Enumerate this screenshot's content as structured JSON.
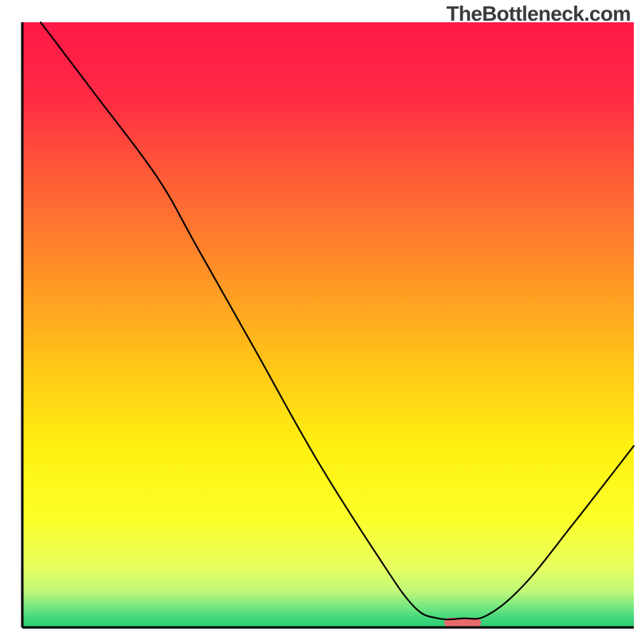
{
  "watermark": "TheBottleneck.com",
  "chart_data": {
    "type": "line",
    "title": "",
    "xlabel": "",
    "ylabel": "",
    "xlim": [
      0,
      100
    ],
    "ylim": [
      0,
      100
    ],
    "background_gradient": {
      "type": "vertical",
      "stops": [
        {
          "offset": 0.0,
          "color": "#ff1848"
        },
        {
          "offset": 0.12,
          "color": "#ff2a44"
        },
        {
          "offset": 0.25,
          "color": "#ff5a38"
        },
        {
          "offset": 0.4,
          "color": "#ff8c28"
        },
        {
          "offset": 0.55,
          "color": "#ffc018"
        },
        {
          "offset": 0.7,
          "color": "#fff010"
        },
        {
          "offset": 0.82,
          "color": "#fbff28"
        },
        {
          "offset": 0.9,
          "color": "#e8ff60"
        },
        {
          "offset": 0.94,
          "color": "#c0f878"
        },
        {
          "offset": 0.965,
          "color": "#78e880"
        },
        {
          "offset": 0.985,
          "color": "#40d87c"
        },
        {
          "offset": 1.0,
          "color": "#28cc70"
        }
      ]
    },
    "axis_color": "#000000",
    "series": [
      {
        "name": "bottleneck-curve",
        "color": "#000000",
        "stroke_width": 2.0,
        "points": [
          {
            "x": 3.0,
            "y": 100.0
          },
          {
            "x": 12.0,
            "y": 88.0
          },
          {
            "x": 22.0,
            "y": 74.5
          },
          {
            "x": 28.5,
            "y": 63.0
          },
          {
            "x": 38.0,
            "y": 46.0
          },
          {
            "x": 48.0,
            "y": 28.0
          },
          {
            "x": 58.0,
            "y": 12.0
          },
          {
            "x": 64.0,
            "y": 3.5
          },
          {
            "x": 68.0,
            "y": 1.5
          },
          {
            "x": 72.0,
            "y": 1.5
          },
          {
            "x": 76.0,
            "y": 2.0
          },
          {
            "x": 82.0,
            "y": 7.0
          },
          {
            "x": 90.0,
            "y": 17.0
          },
          {
            "x": 100.0,
            "y": 30.0
          }
        ]
      }
    ],
    "markers": [
      {
        "name": "optimal-marker",
        "color": "#e56b6b",
        "x_center": 72.0,
        "y_center": 0.8,
        "width": 6.0,
        "height": 1.6,
        "rx": 0.8
      }
    ]
  }
}
